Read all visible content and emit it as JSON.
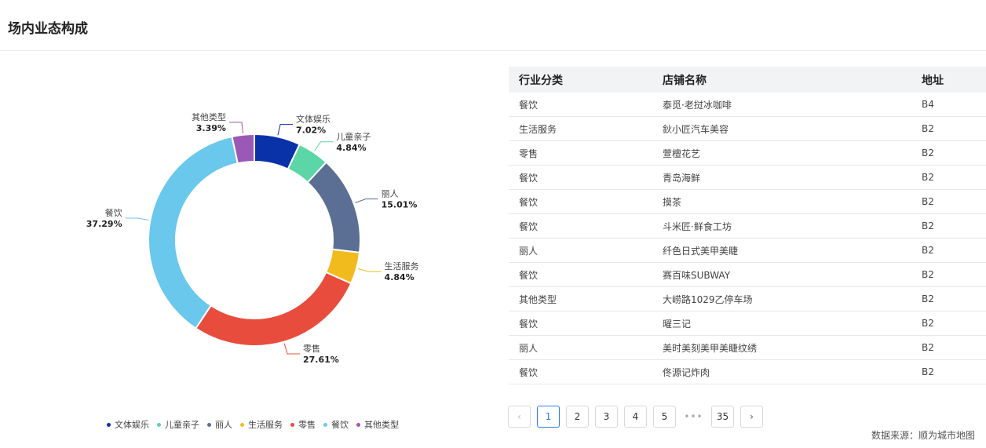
{
  "header": {
    "title": "场内业态构成"
  },
  "chart_data": {
    "type": "pie",
    "categories": [
      "文体娱乐",
      "儿童亲子",
      "丽人",
      "生活服务",
      "零售",
      "餐饮",
      "其他类型"
    ],
    "values": [
      7.02,
      4.84,
      15.01,
      4.84,
      27.61,
      37.29,
      3.39
    ],
    "value_labels": [
      "7.02%",
      "4.84%",
      "15.01%",
      "4.84%",
      "27.61%",
      "37.29%",
      "3.39%"
    ],
    "colors": [
      "#0a32a8",
      "#5cd6a6",
      "#5b6f94",
      "#f2bb1d",
      "#e84c3d",
      "#6ac8ec",
      "#9b59b6"
    ],
    "donut": true,
    "legend": "bottom"
  },
  "table": {
    "headers": [
      "行业分类",
      "店铺名称",
      "地址"
    ],
    "rows": [
      [
        "餐饮",
        "泰觅·老挝冰咖啡",
        "B4"
      ],
      [
        "生活服务",
        "鈥小匠汽车美容",
        "B2"
      ],
      [
        "零售",
        "萱檀花艺",
        "B2"
      ],
      [
        "餐饮",
        "青岛海鲜",
        "B2"
      ],
      [
        "餐饮",
        "摸茶",
        "B2"
      ],
      [
        "餐饮",
        "斗米匠·鲜食工坊",
        "B2"
      ],
      [
        "丽人",
        "纤色日式美甲美睫",
        "B2"
      ],
      [
        "餐饮",
        "赛百味SUBWAY",
        "B2"
      ],
      [
        "其他类型",
        "大崂路1029乙停车场",
        "B2"
      ],
      [
        "餐饮",
        "曜三记",
        "B2"
      ],
      [
        "丽人",
        "美时美刻美甲美睫纹绣",
        "B2"
      ],
      [
        "餐饮",
        "佟源记炸肉",
        "B2"
      ]
    ]
  },
  "pagination": {
    "prev": "‹",
    "pages": [
      "1",
      "2",
      "3",
      "4",
      "5"
    ],
    "ellipsis": "•••",
    "last": "35",
    "next": "›",
    "current": "1"
  },
  "footer": {
    "source": "数据来源：顺为城市地图"
  }
}
